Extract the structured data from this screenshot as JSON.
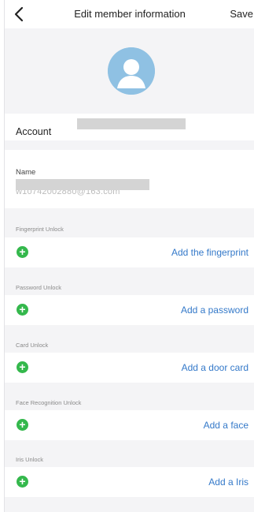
{
  "header": {
    "back_icon": "chevron-left-icon",
    "title": "Edit member information",
    "save_label": "Save"
  },
  "avatar": {
    "icon": "user-avatar-icon",
    "color": "#8fc1e3"
  },
  "account": {
    "label": "Account"
  },
  "name": {
    "label": "Name",
    "value": "w10742002880@163.com"
  },
  "unlock_sections": [
    {
      "label": "Fingerprint Unlock",
      "action": "Add the fingerprint"
    },
    {
      "label": "Password Unlock",
      "action": "Add a password"
    },
    {
      "label": "Card Unlock",
      "action": "Add a door card"
    },
    {
      "label": "Face Recognition Unlock",
      "action": "Add a face"
    },
    {
      "label": "Iris Unlock",
      "action": "Add a Iris"
    }
  ],
  "colors": {
    "accent": "#3479c9",
    "add_green": "#34b84c",
    "background": "#f4f4f6"
  }
}
